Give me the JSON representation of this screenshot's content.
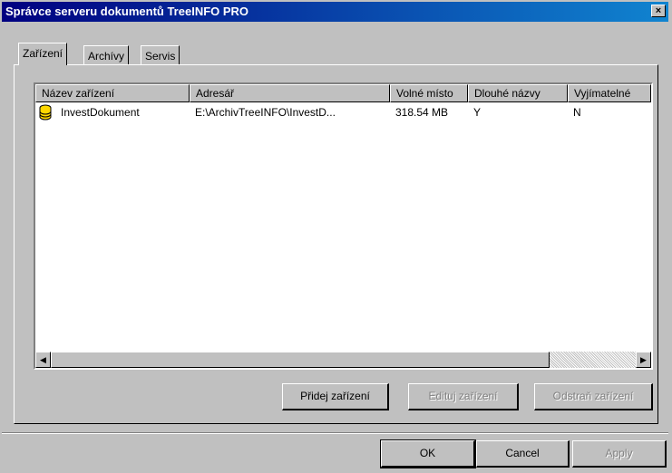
{
  "window": {
    "title": "Správce serveru dokumentů TreeINFO PRO",
    "close_label": "×"
  },
  "tabs": [
    {
      "label": "Zařízení",
      "active": true
    },
    {
      "label": "Archívy",
      "active": false
    },
    {
      "label": "Servis",
      "active": false
    }
  ],
  "list": {
    "columns": [
      "Název zařízení",
      "Adresář",
      "Volné místo",
      "Dlouhé názvy",
      "Vyjímatelné"
    ],
    "rows": [
      {
        "icon": "database-icon",
        "cells": [
          "InvestDokument",
          "E:\\ArchivTreeINFO\\InvestD...",
          "318.54 MB",
          "Y",
          "N"
        ]
      }
    ],
    "scroll": {
      "left_arrow": "◀",
      "right_arrow": "▶"
    }
  },
  "actions": {
    "add_device": "Přidej zařízení",
    "edit_device": "Edituj zařízení",
    "remove_device": "Odstraň zařízení"
  },
  "dialog_buttons": {
    "ok": "OK",
    "cancel": "Cancel",
    "apply": "Apply"
  },
  "colors": {
    "title_bar": "#000080",
    "face": "#c0c0c0",
    "icon_yellow": "#ffd800"
  }
}
